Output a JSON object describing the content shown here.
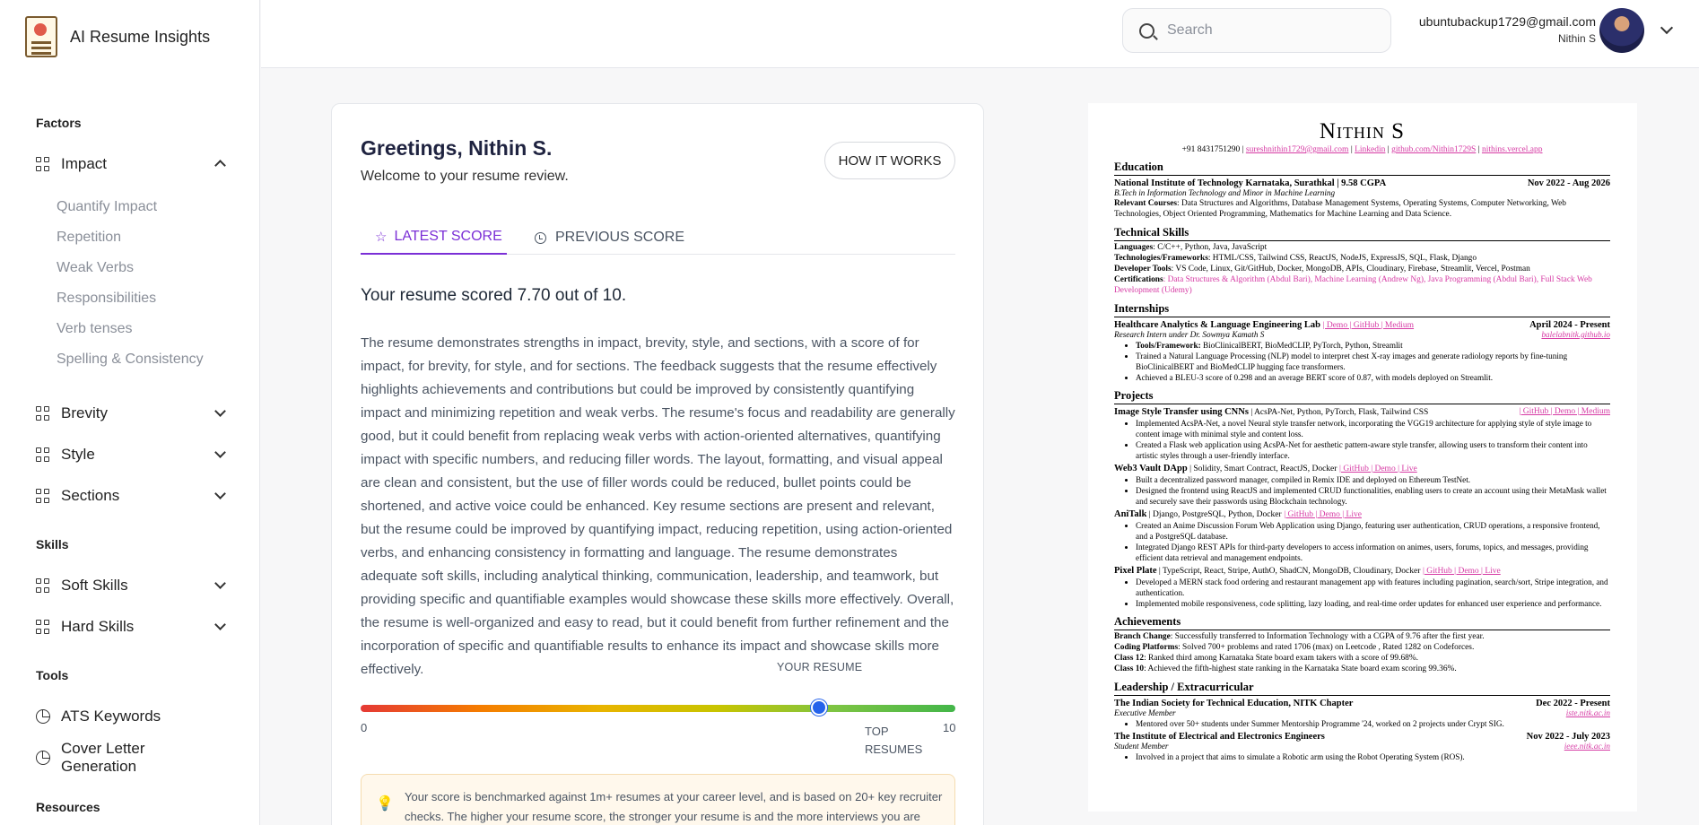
{
  "brand": {
    "name": "AI Resume Insights"
  },
  "sidebar": {
    "factors_heading": "Factors",
    "impact": {
      "label": "Impact",
      "subitems": [
        "Quantify Impact",
        "Repetition",
        "Weak Verbs",
        "Responsibilities",
        "Verb tenses",
        "Spelling & Consistency"
      ]
    },
    "brevity": "Brevity",
    "style": "Style",
    "sections": "Sections",
    "skills_heading": "Skills",
    "soft_skills": "Soft Skills",
    "hard_skills": "Hard Skills",
    "tools_heading": "Tools",
    "ats_keywords": "ATS Keywords",
    "cover_letter": "Cover Letter Generation",
    "resources_heading": "Resources"
  },
  "header": {
    "search_placeholder": "Search",
    "user_email": "ubuntubackup1729@gmail.com",
    "user_name": "Nithin S"
  },
  "review": {
    "greeting": "Greetings, Nithin S.",
    "welcome": "Welcome to your resume review.",
    "how_it_works": "HOW IT WORKS",
    "tab_latest": "LATEST SCORE",
    "tab_previous": "PREVIOUS SCORE",
    "score_line": "Your resume scored 7.70 out of 10.",
    "score": 7.7,
    "summary": "The resume demonstrates strengths in impact, brevity, style, and sections, with a score of for impact, for brevity, for style, and for sections. The feedback suggests that the resume effectively highlights achievements and contributions but could be improved by consistently quantifying impact and minimizing repetition and weak verbs. The resume's focus and readability are generally good, but it could benefit from replacing weak verbs with action-oriented alternatives, quantifying impact with specific numbers, and reducing filler words. The layout, formatting, and visual appeal are clean and consistent, but the use of filler words could be reduced, bullet points could be shortened, and active voice could be enhanced. Key resume sections are present and relevant, but the resume could be improved by quantifying impact, reducing repetition, using action-oriented verbs, and enhancing consistency in formatting and language. The resume demonstrates adequate soft skills, including analytical thinking, communication, leadership, and teamwork, but providing specific and quantifiable examples would showcase these skills more effectively. Overall, the resume is well-organized and easy to read, but it could benefit from further refinement and the incorporation of specific and quantifiable results to enhance its impact and showcase skills more effectively.",
    "your_resume_label": "YOUR RESUME",
    "scale_min": "0",
    "scale_top": "TOP RESUMES",
    "scale_max": "10",
    "note": "Your score is benchmarked against 1m+ resumes at your career level, and is based on 20+ key recruiter checks. The higher your resume score, the stronger your resume is and the more interviews you are"
  },
  "resume": {
    "name": "Nithin S",
    "phone": "+91 8431751290 |",
    "links": [
      "sureshnithin1729@gmail.com",
      "Linkedin",
      "github.com/Nithin1729S",
      "nithins.vercel.app"
    ],
    "education_h": "Education",
    "edu_school": "National Institute of Technology Karnataka, Surathkal | 9.58 CGPA",
    "edu_date": "Nov 2022 - Aug 2026",
    "edu_degree": "B.Tech in Information Technology and  Minor in Machine Learning",
    "edu_courses_label": "Relevant Courses",
    "edu_courses": ": Data Structures and Algorithms, Database Management Systems, Operating Systems, Computer Networking, Web Technologies, Object Oriented Programming, Mathematics for Machine Learning and Data Science.",
    "skills_h": "Technical Skills",
    "sk_lang_label": "Languages",
    "sk_lang": ": C/C++, Python, Java, JavaScript",
    "sk_fw_label": "Technologies/Frameworks",
    "sk_fw": ": HTML/CSS, Tailwind CSS, ReactJS, NodeJS, ExpressJS, SQL, Flask, Django",
    "sk_dev_label": "Developer Tools",
    "sk_dev": ": VS Code, Linux, Git/GitHub, Docker, MongoDB, APIs, Cloudinary, Firebase, Streamlit, Vercel, Postman",
    "sk_cert_label": "Certifications",
    "sk_cert": ": Data Structures & Algorithm (Abdul Bari), Machine Learning (Andrew Ng), Java Programming (Abdul Bari), Full Stack Web Development (Udemy)",
    "intern_h": "Internships",
    "intern_title": "Healthcare Analytics & Language Engineering Lab",
    "intern_links": "| Demo | GitHub | Medium",
    "intern_date": "April 2024 - Present",
    "intern_role": "Research Intern under Dr. Sowmya Kamath S",
    "intern_site": "balelabnitk.github.io",
    "intern_b1_label": "Tools/Framework:",
    "intern_b1": " BioClinicalBERT, BioMedCLIP, PyTorch, Python, Streamlit",
    "intern_b2": "Trained a Natural Language Processing (NLP) model to interpret chest X-ray images and generate radiology reports by fine-tuning BioClinicalBERT and BioMedCLIP hugging face transformers.",
    "intern_b3": "Achieved a BLEU-3 score of 0.298 and an average BERT score of 0.87, with models deployed on Streamlit.",
    "projects_h": "Projects",
    "p1_title": "Image Style Transfer using CNNs",
    "p1_stack": " | AcsPA-Net, Python, PyTorch, Flask, Tailwind CSS",
    "p1_links": "| GitHub | Demo | Medium",
    "p1_b1": "Implemented AcsPA-Net, a novel Neural style transfer network, incorporating the VGG19 architecture for applying style of style image to content image with minimal style and content loss.",
    "p1_b2": "Created a Flask web application using AcsPA-Net for aesthetic pattern-aware style transfer, allowing users to transform their content into artistic styles through a user-friendly interface.",
    "p2_title": "Web3 Vault DApp",
    "p2_stack": " | Solidity, Smart Contract, ReactJS, Docker",
    "p2_links": "| GitHub | Demo | Live",
    "p2_b1": "Built a decentralized password manager, compiled in Remix IDE and deployed on Ethereum TestNet.",
    "p2_b2": "Designed the frontend using ReactJS and implemented CRUD functionalities, enabling users to create an account using their MetaMask wallet and securely save their passwords using Blockchain technology.",
    "p3_title": "AniTalk",
    "p3_stack": " | Django, PostgreSQL, Python, Docker",
    "p3_links": "| GitHub | Demo | Live",
    "p3_b1": "Created an Anime Discussion Forum Web Application using Django, featuring user authentication, CRUD operations, a responsive frontend, and a PostgreSQL database.",
    "p3_b2": "Integrated Django REST APIs for third-party developers to access information on animes, users, forums, topics, and messages, providing efficient data retrieval and management endpoints.",
    "p4_title": "Pixel Plate",
    "p4_stack": " | TypeScript, React, Stripe, AuthO, ShadCN, MongoDB, Cloudinary, Docker",
    "p4_links": "| GitHub | Demo | Live",
    "p4_b1": "Developed a MERN stack food ordering and restaurant management app with features including pagination, search/sort, Stripe integration, and authentication.",
    "p4_b2": "Implemented mobile responsiveness, code splitting, lazy loading, and real-time order updates for enhanced user experience and performance.",
    "ach_h": "Achievements",
    "ach1_label": "Branch Change",
    "ach1": ": Successfully transferred to Information Technology with a CGPA of 9.76 after the first year.",
    "ach2_label": "Coding Platforms",
    "ach2": ": Solved 700+ problems and rated 1706 (max) on Leetcode , Rated 1282 on Codeforces.",
    "ach3_label": "Class 12",
    "ach3": ": Ranked third among Karnataka State board exam takers with a score of 99.68%.",
    "ach4_label": "Class 10",
    "ach4": ": Achieved the fifth-highest state ranking in the Karnataka State board exam scoring 99.36%.",
    "lead_h": "Leadership / Extracurricular",
    "l1_title": "The Indian Society for Technical Education, NITK Chapter",
    "l1_date": "Dec 2022 - Present",
    "l1_role": "Executive Member",
    "l1_site": "iste.nitk.ac.in",
    "l1_b1": "Mentored over 50+ students under Summer Mentorship Programme '24, worked on 2 projects under Crypt SIG.",
    "l2_title": "The Institute of Electrical and Electronics Engineers",
    "l2_date": "Nov 2022 - July 2023",
    "l2_role": "Student Member",
    "l2_site": "ieee.nitk.ac.in",
    "l2_b1": "Involved in a project that aims to simulate a Robotic arm using the Robot Operating System (ROS)."
  }
}
